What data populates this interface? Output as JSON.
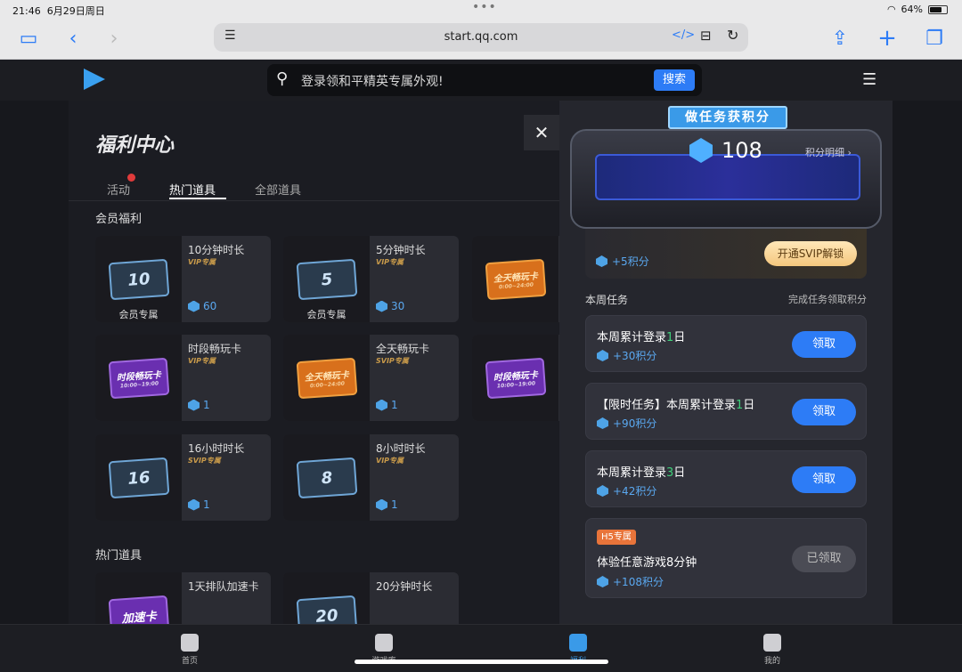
{
  "status": {
    "time": "21:46",
    "date": "6月29日周日",
    "battery": "64%"
  },
  "browser": {
    "url": "start.qq.com"
  },
  "header": {
    "search_placeholder": "登录领和平精英专属外观!",
    "search_button": "搜索"
  },
  "page": {
    "title": "福利中心",
    "tabs": [
      {
        "label": "活动"
      },
      {
        "label": "热门道具"
      },
      {
        "label": "全部道具"
      }
    ],
    "section_vip": "会员福利",
    "section_hot": "热门道具",
    "cards": [
      {
        "name": "10分钟时长",
        "tag": "VIP专属",
        "price": "60",
        "ticket": "10",
        "caption": "会员专属"
      },
      {
        "name": "5分钟时长",
        "tag": "VIP专属",
        "price": "30",
        "ticket": "5",
        "caption": "会员专属"
      },
      {
        "name": "时段畅玩卡",
        "tag": "VIP专属",
        "price": "1",
        "ticket": "时段畅玩卡",
        "sub": "10:00~19:00"
      },
      {
        "name": "全天畅玩卡",
        "tag": "SVIP专属",
        "price": "1",
        "ticket": "全天畅玩卡",
        "sub": "0:00~24:00"
      },
      {
        "name": "16小时时长",
        "tag": "SVIP专属",
        "price": "1",
        "ticket": "16"
      },
      {
        "name": "8小时时长",
        "tag": "VIP专属",
        "price": "1",
        "ticket": "8"
      },
      {
        "name": "1天排队加速卡",
        "ticket": "加速卡"
      },
      {
        "name": "20分钟时长",
        "ticket": "20"
      }
    ],
    "partial_tickets": [
      {
        "ticket": "全天畅玩卡",
        "sub": "0:00~24:00"
      },
      {
        "ticket": "时段畅玩卡",
        "sub": "10:00~19:00"
      }
    ]
  },
  "panel": {
    "title": "做任务获积分",
    "points": "108",
    "points_link": "积分明细 ›",
    "svip_reward": "+5积分",
    "svip_button": "开通SVIP解锁",
    "week_label": "本周任务",
    "week_hint": "完成任务领取积分",
    "tasks": [
      {
        "pre": "本周累计登录",
        "num": "1",
        "post": "日",
        "points": "+30积分",
        "button": "领取"
      },
      {
        "pre": "【限时任务】本周累计登录",
        "num": "1",
        "post": "日",
        "points": "+90积分",
        "button": "领取"
      },
      {
        "pre": "本周累计登录",
        "num": "3",
        "post": "日",
        "points": "+42积分",
        "button": "领取"
      },
      {
        "badge": "H5专属",
        "title": "体验任意游戏8分钟",
        "points": "+108积分",
        "button": "已领取"
      }
    ]
  },
  "bottom_nav": [
    {
      "label": "首页"
    },
    {
      "label": "游戏库"
    },
    {
      "label": "福利"
    },
    {
      "label": "我的"
    }
  ]
}
